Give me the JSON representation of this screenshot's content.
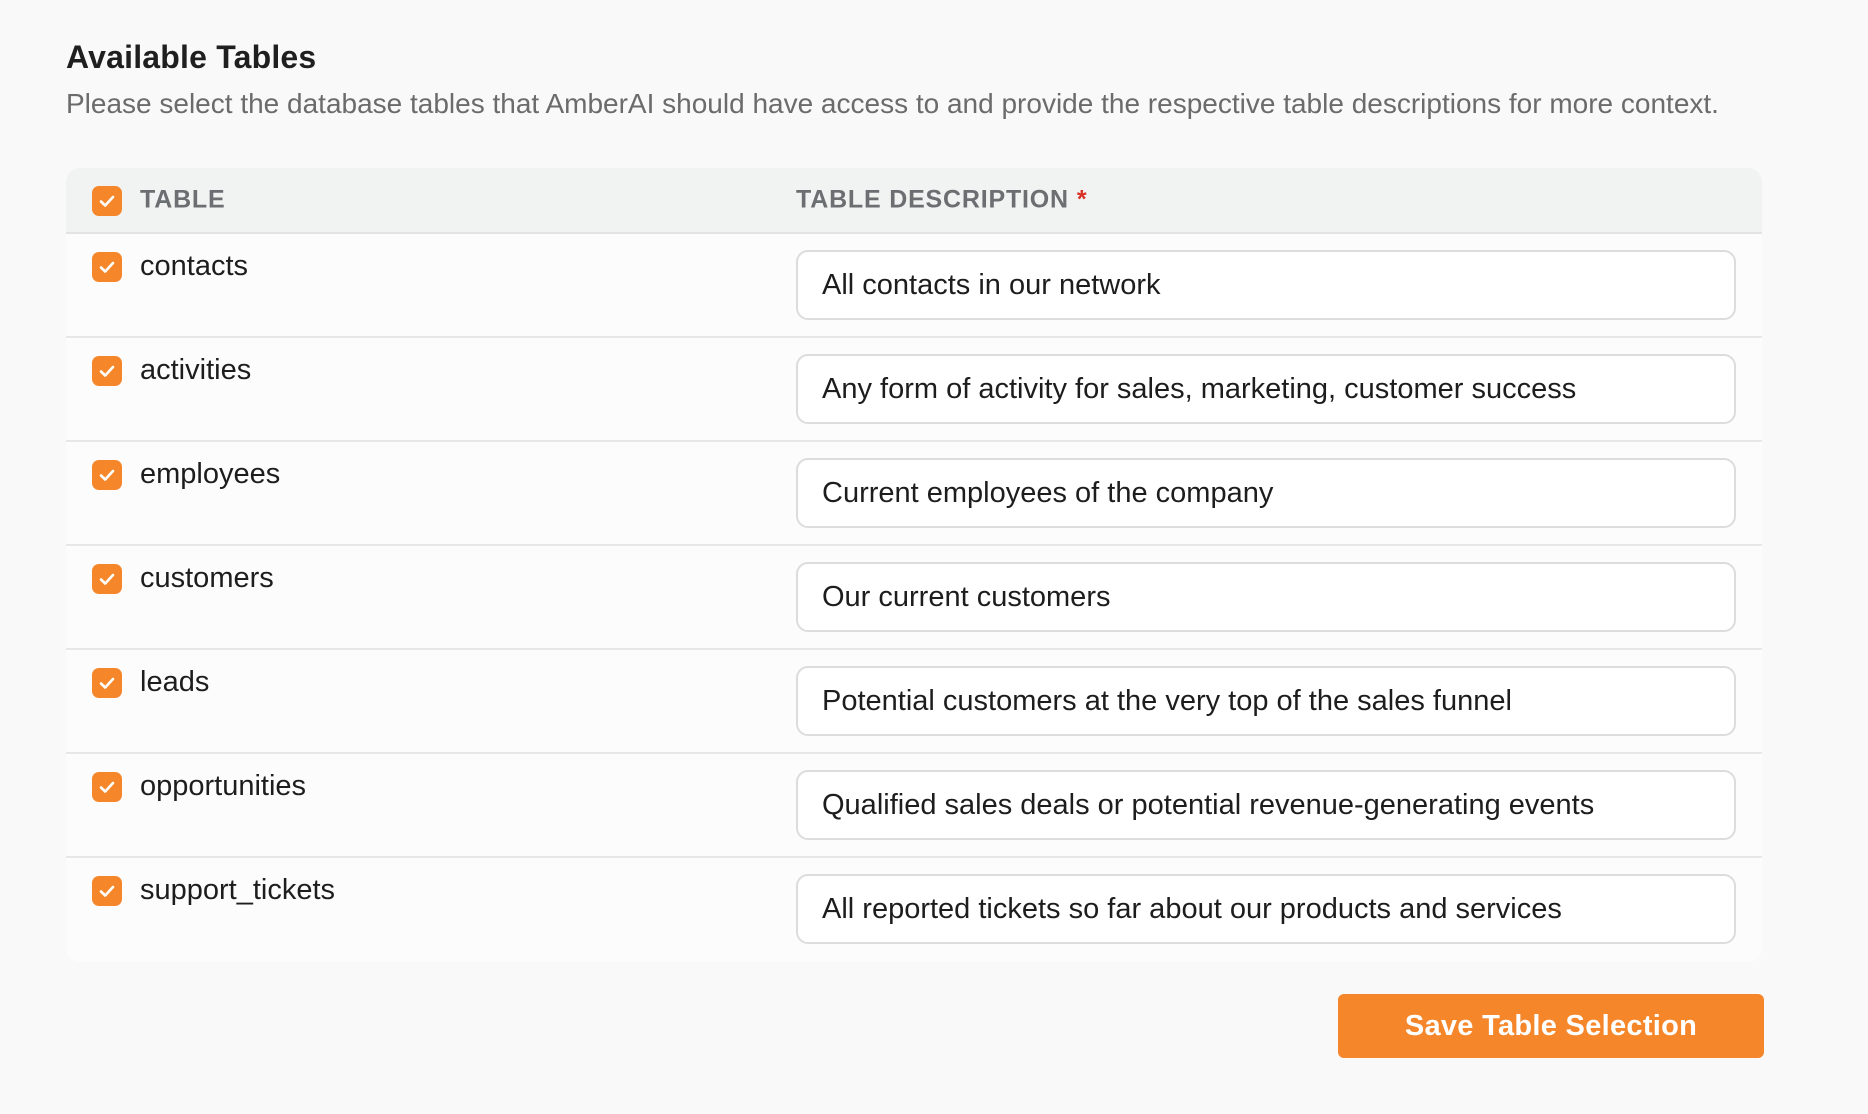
{
  "header": {
    "title": "Available Tables",
    "subtitle": "Please select the database tables that AmberAI should have access to and provide the respective table descriptions for more context."
  },
  "table": {
    "columns": {
      "table": "TABLE",
      "description": "TABLE DESCRIPTION",
      "required_marker": "*"
    },
    "select_all_checked": true,
    "rows": [
      {
        "name": "contacts",
        "checked": true,
        "description": "All contacts in our network"
      },
      {
        "name": "activities",
        "checked": true,
        "description": "Any form of activity for sales, marketing, customer success"
      },
      {
        "name": "employees",
        "checked": true,
        "description": "Current employees of the company"
      },
      {
        "name": "customers",
        "checked": true,
        "description": "Our current customers"
      },
      {
        "name": "leads",
        "checked": true,
        "description": "Potential customers at the very top of the sales funnel"
      },
      {
        "name": "opportunities",
        "checked": true,
        "description": "Qualified sales deals or potential revenue-generating events"
      },
      {
        "name": "support_tickets",
        "checked": true,
        "description": "All reported tickets so far about our products and services"
      }
    ]
  },
  "actions": {
    "save_label": "Save Table Selection"
  },
  "colors": {
    "accent": "#f5862a",
    "required": "#d93025"
  },
  "icons": {
    "checkbox": "check-icon"
  }
}
